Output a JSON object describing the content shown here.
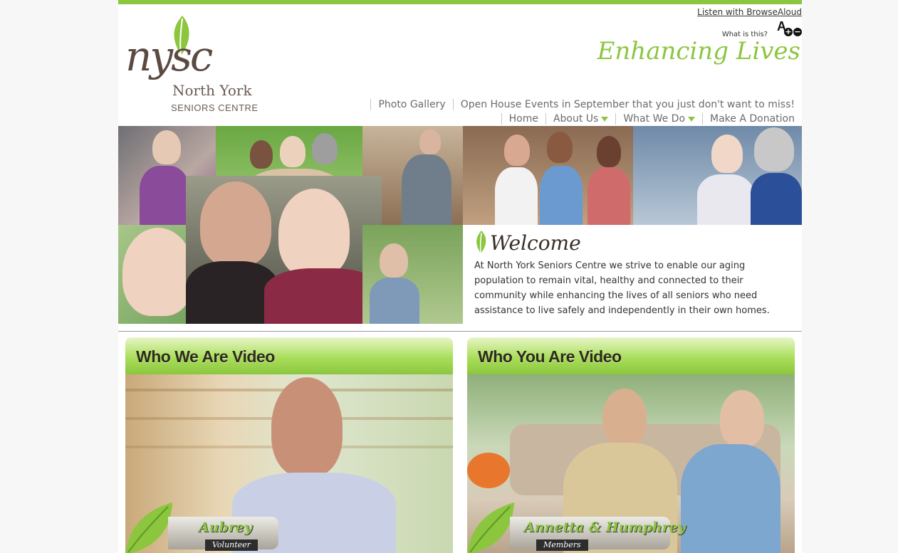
{
  "logo": {
    "mark": "nysc",
    "name": "North York",
    "subtitle": "SENIORS CENTRE"
  },
  "header": {
    "browsealoud_link": "Listen with BrowseAloud",
    "what_is_this": "What is this?",
    "tagline": "Enhancing Lives"
  },
  "subnav": {
    "items": [
      {
        "label": "Photo Gallery"
      },
      {
        "label": "Open House Events in September that you just don't want to miss!"
      }
    ]
  },
  "mainnav": {
    "items": [
      {
        "label": "Home"
      },
      {
        "label": "About Us"
      },
      {
        "label": "What We Do"
      },
      {
        "label": "Make A Donation"
      }
    ]
  },
  "welcome": {
    "title": "Welcome",
    "text": "At North York Seniors Centre we strive to enable our aging population to remain vital, healthy and connected to their community while enhancing the lives of all seniors who need assistance to live safely and independently in their own homes."
  },
  "videos": [
    {
      "title": "Who We Are Video",
      "name": "Aubrey",
      "role": "Volunteer"
    },
    {
      "title": "Who You Are Video",
      "name": "Annetta & Humphrey",
      "role": "Members"
    }
  ],
  "colors": {
    "accent": "#8cc63f",
    "text": "#333333",
    "brown": "#5a4a42"
  }
}
